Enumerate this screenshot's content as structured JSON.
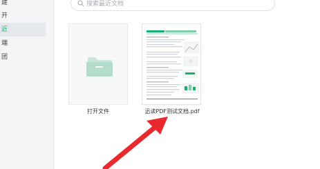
{
  "sidebar": {
    "items": [
      {
        "label": "建"
      },
      {
        "label": "开"
      },
      {
        "label": "近"
      },
      {
        "label": "端"
      },
      {
        "label": "团"
      }
    ]
  },
  "search": {
    "placeholder": "搜索最近文档"
  },
  "files": [
    {
      "label": "打开文件",
      "icon": "folder-icon"
    },
    {
      "label": "迅读PDF测试文档.pdf",
      "icon": "pdf-thumbnail"
    }
  ],
  "colors": {
    "accent": "#16b06f",
    "arrow": "#e8292d"
  }
}
